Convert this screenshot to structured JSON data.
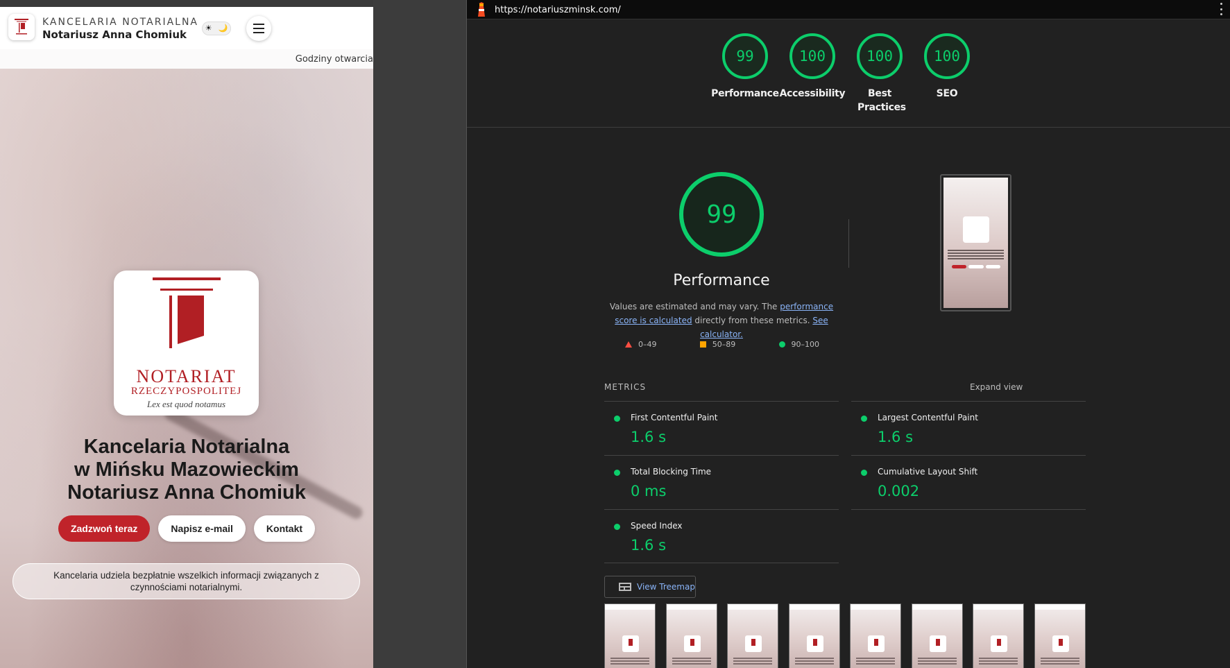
{
  "site": {
    "brand_top": "KANCELARIA NOTARIALNA",
    "brand_name": "Notariusz Anna Chomiuk",
    "theme_sun": "☀",
    "theme_moon": "🌙",
    "hours_text": "Godziny otwarcia",
    "card": {
      "word1": "NOTARIAT",
      "word2": "RZECZYPOSPOLITEJ",
      "motto": "Lex est quod notamus"
    },
    "hero_title_lines": [
      "Kancelaria Notarialna",
      "w Mińsku Mazowieckim",
      "Notariusz Anna Chomiuk"
    ],
    "buttons": {
      "call": "Zadzwoń teraz",
      "email": "Napisz e-mail",
      "contact": "Kontakt"
    },
    "info": "Kancelaria udziela bezpłatnie wszelkich informacji związanych z czynnościami notarialnymi."
  },
  "lighthouse": {
    "url": "https://notariuszminsk.com/",
    "scores": [
      {
        "label": "Performance",
        "value": "99"
      },
      {
        "label": "Accessibility",
        "value": "100"
      },
      {
        "label": "Best Practices",
        "value": "100"
      },
      {
        "label": "SEO",
        "value": "100"
      }
    ],
    "performance": {
      "score": "99",
      "title": "Performance",
      "desc_prefix": "Values are estimated and may vary. The ",
      "desc_link1": "performance score is calculated",
      "desc_middle": " directly from these metrics. ",
      "desc_link2": "See calculator."
    },
    "legend": {
      "fail": "0–49",
      "average": "50–89",
      "pass": "90–100"
    },
    "metrics_header": "METRICS",
    "expand_label": "Expand view",
    "metrics": [
      {
        "name": "First Contentful Paint",
        "value": "1.6 s"
      },
      {
        "name": "Largest Contentful Paint",
        "value": "1.6 s"
      },
      {
        "name": "Total Blocking Time",
        "value": "0 ms"
      },
      {
        "name": "Cumulative Layout Shift",
        "value": "0.002"
      },
      {
        "name": "Speed Index",
        "value": "1.6 s"
      }
    ],
    "treemap_label": "View Treemap",
    "filmstrip_frames": 8,
    "colors": {
      "pass": "#0cce6b",
      "average": "#ffa400",
      "fail": "#ff4e42",
      "link": "#8ab4f8"
    }
  }
}
